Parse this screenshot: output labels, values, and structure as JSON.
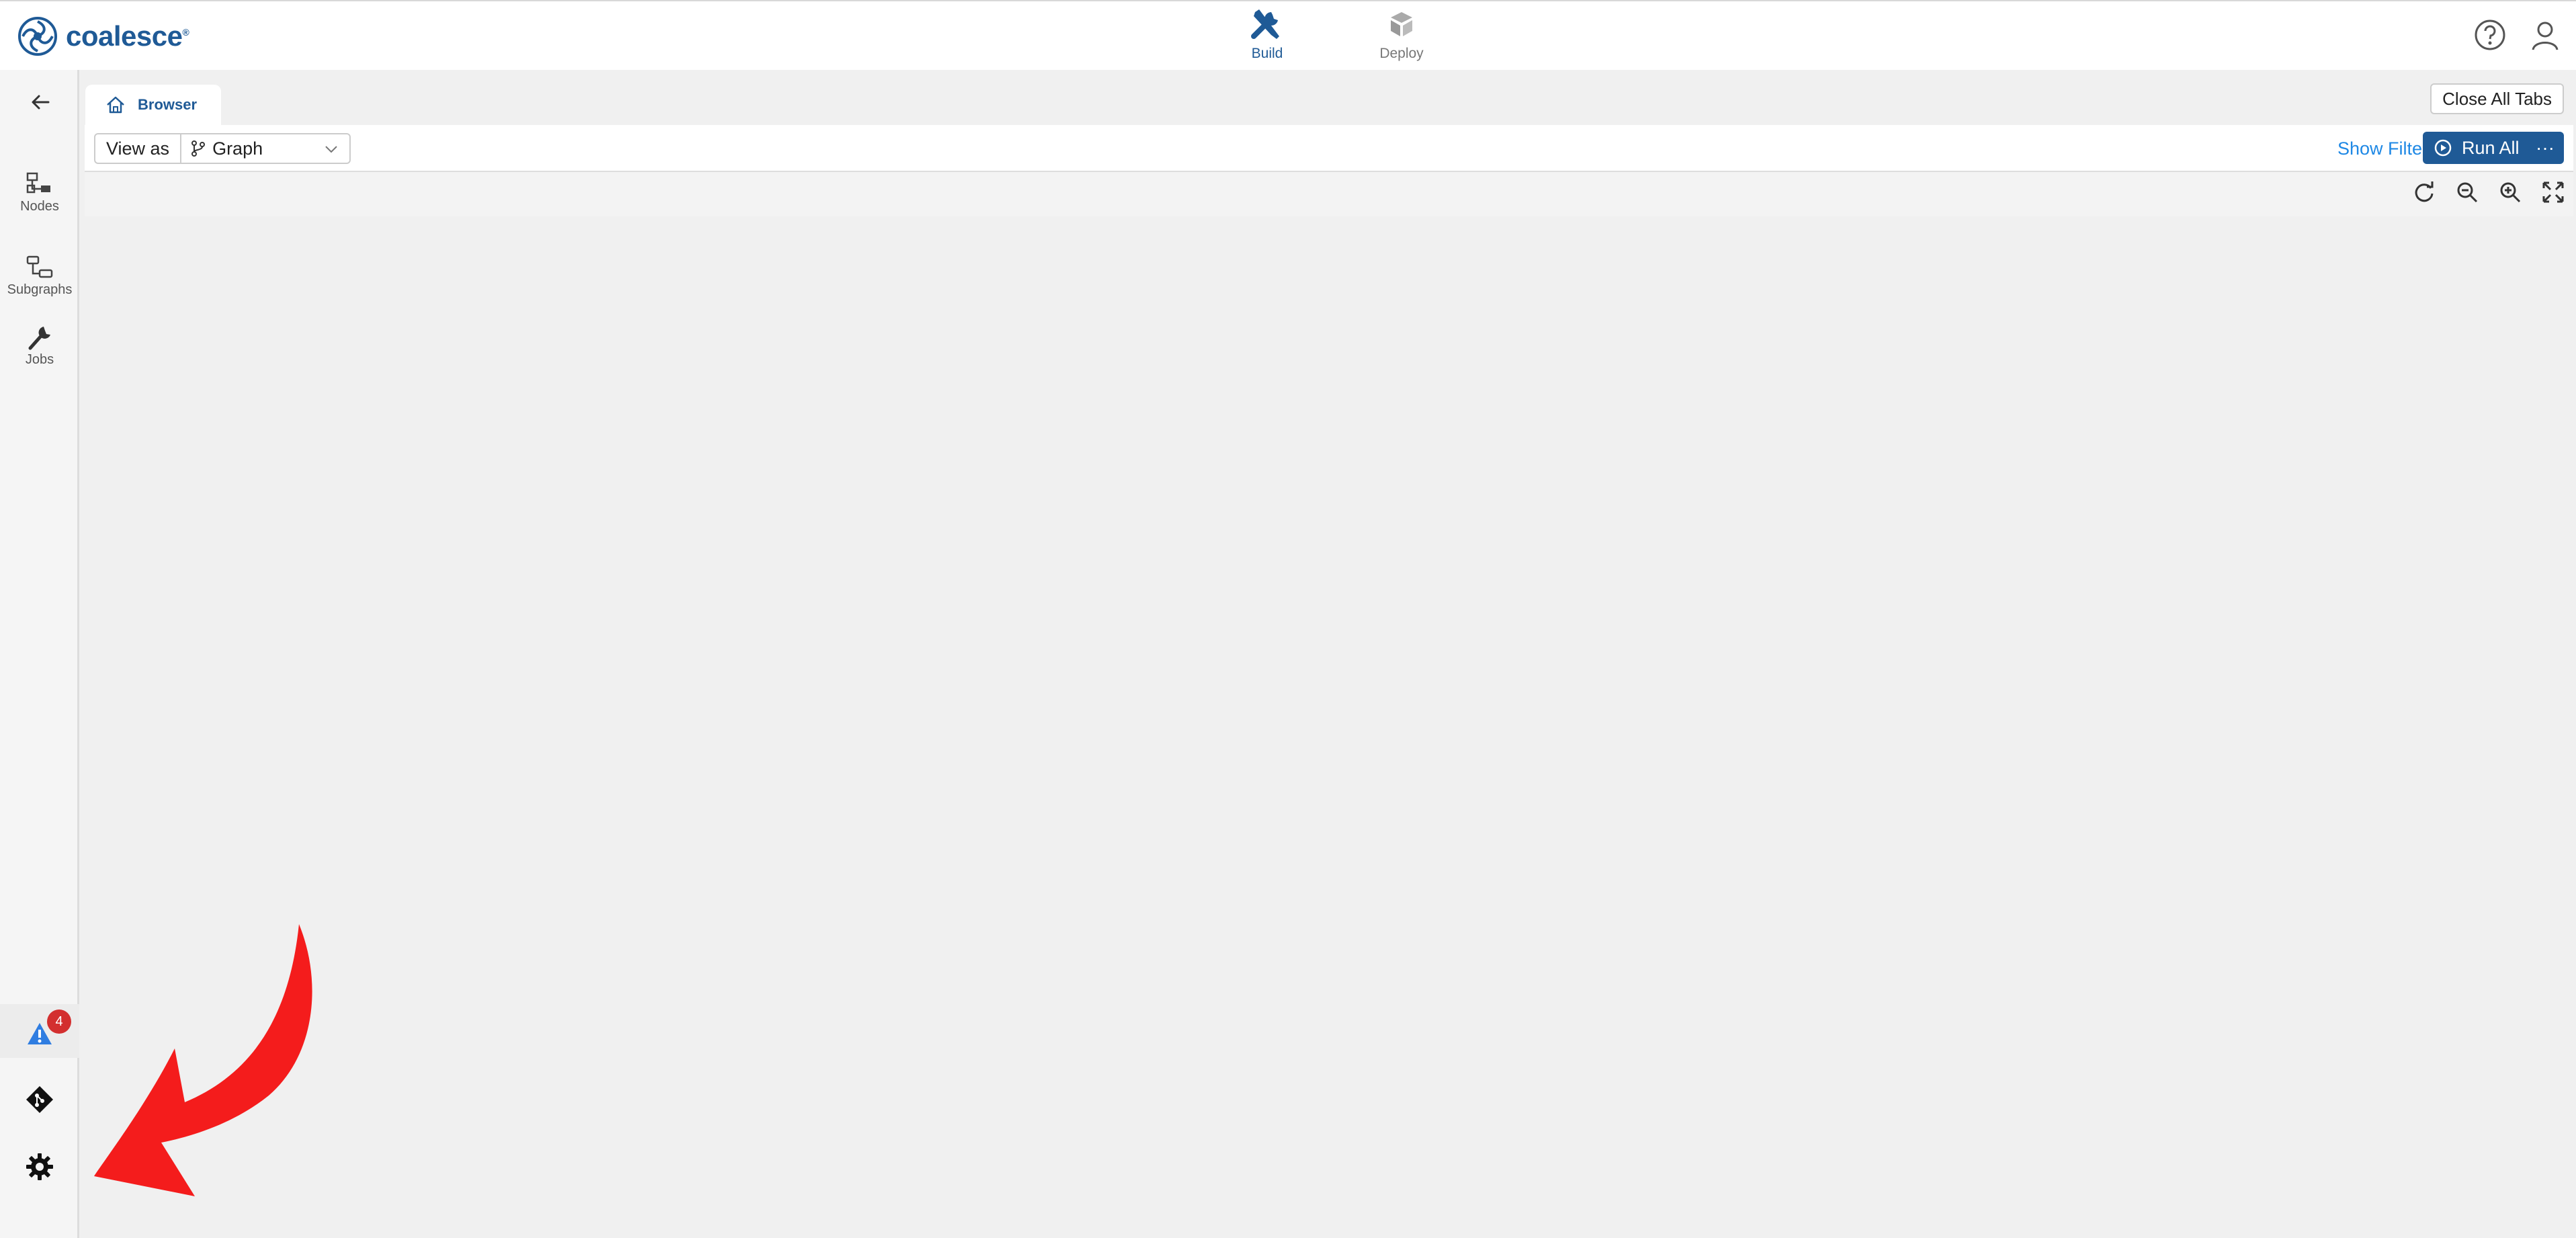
{
  "app": {
    "name": "coalesce",
    "reg_mark": "®"
  },
  "header": {
    "modes": [
      {
        "label": "Build",
        "icon": "wrench-screwdriver-icon",
        "active": true
      },
      {
        "label": "Deploy",
        "icon": "deploy-cubes-icon",
        "active": false
      }
    ],
    "right_icons": [
      "help-circle-icon",
      "user-icon"
    ]
  },
  "sidebar": {
    "items": [
      {
        "label": "Nodes",
        "icon": "nodes-icon"
      },
      {
        "label": "Subgraphs",
        "icon": "subgraphs-icon"
      },
      {
        "label": "Jobs",
        "icon": "wrench-icon"
      }
    ],
    "bottom": {
      "alert_count": "4",
      "icons": [
        "warning-icon",
        "git-icon",
        "gear-icon"
      ]
    }
  },
  "tabs": {
    "items": [
      {
        "label": "Browser",
        "icon": "home-icon"
      }
    ],
    "close_all_label": "Close All Tabs"
  },
  "toolbar": {
    "view_as_label": "View as",
    "view_mode": "Graph",
    "show_filter_label": "Show Filter",
    "run_all_label": "Run All",
    "more_label": "···"
  },
  "canvas_controls": [
    "refresh-icon",
    "zoom-out-icon",
    "zoom-in-icon",
    "fit-screen-icon"
  ],
  "colors": {
    "brand": "#1f5a96",
    "link": "#1e88e5",
    "badge": "#d32f2f",
    "annotation_arrow": "#f41c1c"
  }
}
